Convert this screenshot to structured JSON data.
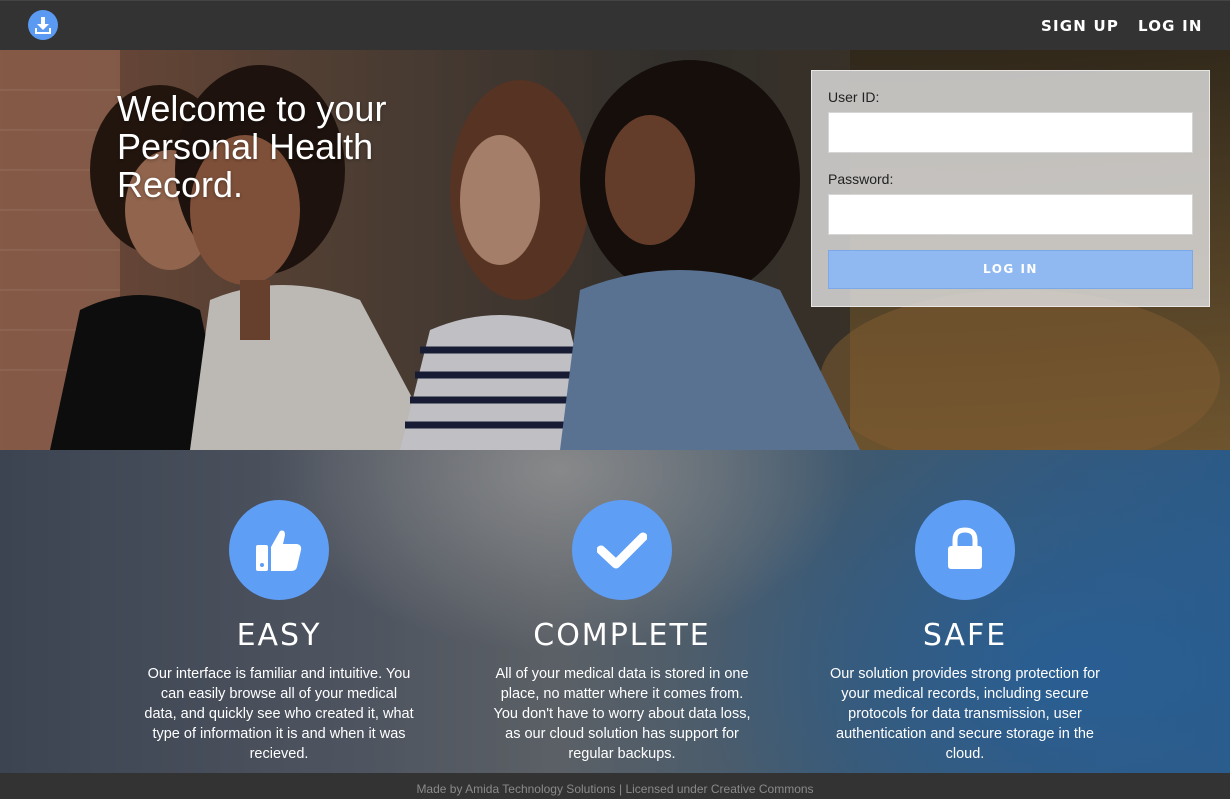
{
  "nav": {
    "logo_icon": "download-icon",
    "signup_label": "SIGN UP",
    "login_label": "LOG IN"
  },
  "hero": {
    "title": "Welcome to your Personal Health Record."
  },
  "login": {
    "user_label": "User ID:",
    "user_value": "",
    "password_label": "Password:",
    "password_value": "",
    "button_label": "LOG IN"
  },
  "features": [
    {
      "icon": "thumbs-up-icon",
      "title": "EASY",
      "text": "Our interface is familiar and intuitive. You can easily browse all of your medical data, and quickly see who created it, what type of information it is and when it was recieved."
    },
    {
      "icon": "checkmark-icon",
      "title": "COMPLETE",
      "text": "All of your medical data is stored in one place, no matter where it comes from. You don't have to worry about data loss, as our cloud solution has support for regular backups."
    },
    {
      "icon": "lock-icon",
      "title": "SAFE",
      "text": "Our solution provides strong protection for your medical records, including secure protocols for data transmission, user authentication and secure storage in the cloud."
    }
  ],
  "footer": {
    "text": "Made by Amida Technology Solutions | Licensed under Creative Commons"
  },
  "colors": {
    "nav_bg": "#333333",
    "accent_blue": "#5f9ef5",
    "login_button": "#8fb9f0"
  }
}
